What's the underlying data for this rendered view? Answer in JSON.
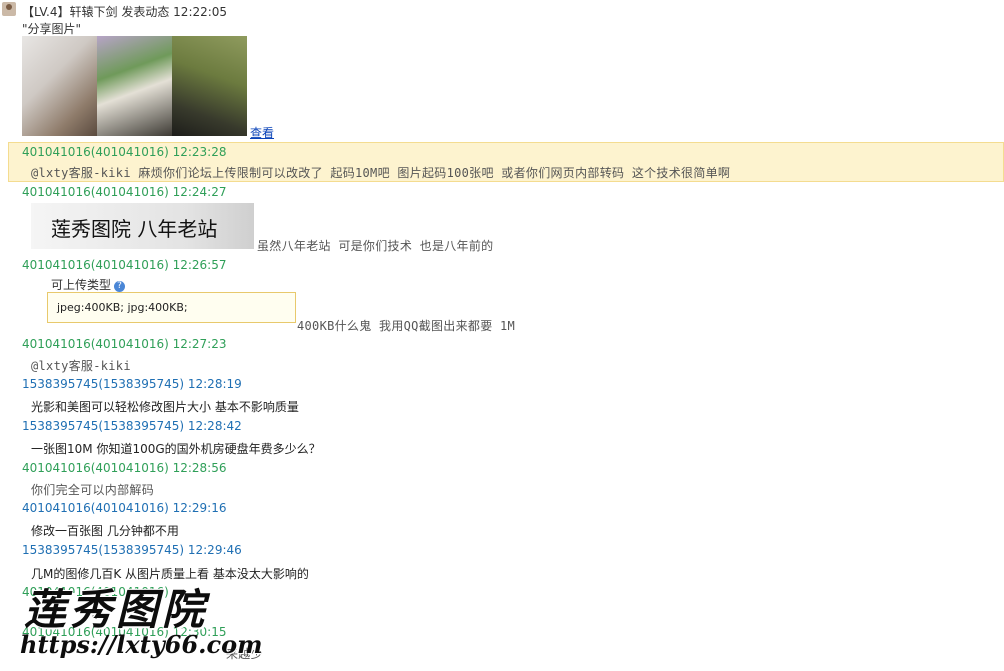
{
  "post": {
    "level": "【LV.4】",
    "author": "轩辕下剑",
    "action": "发表动态",
    "time": "12:22:05",
    "caption": "\"分享图片\"",
    "view_link": "查看"
  },
  "comments": [
    {
      "meta": "401041016(401041016) 12:23:28",
      "text": "@lxty客服-kiki 麻烦你们论坛上传限制可以改改了 起码10M吧 图片起码100张吧 或者你们网页内部转码 这个技术很简单啊"
    },
    {
      "meta": "401041016(401041016) 12:24:27",
      "image_text": "莲秀图院 八年老站",
      "text": "虽然八年老站 可是你们技术 也是八年前的"
    },
    {
      "meta": "401041016(401041016) 12:26:57",
      "upload_label": "可上传类型",
      "upload_tip": "jpeg:400KB; jpg:400KB;",
      "text": "400KB什么鬼 我用QQ截图出来都要 1M"
    },
    {
      "meta": "401041016(401041016) 12:27:23",
      "text": "@lxty客服-kiki"
    },
    {
      "meta": "1538395745(1538395745) 12:28:19",
      "text": "光影和美图可以轻松修改图片大小 基本不影响质量"
    },
    {
      "meta": "1538395745(1538395745) 12:28:42",
      "text": "一张图10M  你知道100G的国外机房硬盘年费多少么？"
    },
    {
      "meta": "401041016(401041016) 12:28:56",
      "text": "你们完全可以内部解码"
    },
    {
      "meta": "401041016(401041016) 12:29:16",
      "text": "修改一百张图 几分钟都不用"
    },
    {
      "meta": "1538395745(1538395745) 12:29:46",
      "text": "几M的图修几百K  从图片质量上看 基本没太大影响的"
    },
    {
      "meta": "401041016(401041016)",
      "text": "实"
    },
    {
      "meta": "401041016(401041016) 12:30:15",
      "text": "来越少"
    }
  ],
  "watermark": {
    "title": "莲秀图院",
    "url": "https://lxty66.com"
  },
  "colors": {
    "highlight_bg": "#fdf3cf",
    "green_meta": "#2f9f58",
    "blue_meta": "#1f6fb3",
    "link": "#0a43b8"
  }
}
